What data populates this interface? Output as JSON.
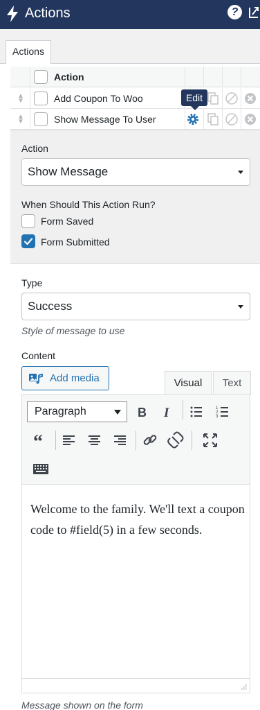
{
  "header": {
    "title": "Actions",
    "help_label": "?"
  },
  "tabs": {
    "actions_label": "Actions"
  },
  "table": {
    "column_action": "Action",
    "rows": [
      {
        "label": "Add Coupon To Woo"
      },
      {
        "label": "Show Message To User"
      }
    ],
    "tooltip": "Edit"
  },
  "settings": {
    "action_label": "Action",
    "action_value": "Show Message",
    "when_label": "When Should This Action Run?",
    "options": [
      {
        "label": "Form Saved",
        "checked": false
      },
      {
        "label": "Form Submitted",
        "checked": true
      }
    ]
  },
  "message": {
    "type_label": "Type",
    "type_value": "Success",
    "type_help": "Style of message to use",
    "content_label": "Content",
    "add_media_label": "Add media",
    "tab_visual": "Visual",
    "tab_text": "Text",
    "format_value": "Paragraph",
    "body": "Welcome to the family. We'll text a coupon code to #field(5) in a few seconds.",
    "content_help": "Message shown on the form"
  },
  "colors": {
    "header_bg": "#23375e",
    "accent": "#2271b1",
    "checked": "#2271b1"
  },
  "icons": [
    "bolt-icon",
    "help-icon",
    "expand-icon",
    "drag-handle-icon",
    "gear-icon",
    "duplicate-icon",
    "disable-icon",
    "delete-icon",
    "media-icon",
    "bold-icon",
    "italic-icon",
    "bullet-list-icon",
    "numbered-list-icon",
    "blockquote-icon",
    "align-left-icon",
    "align-center-icon",
    "align-right-icon",
    "link-icon",
    "unlink-icon",
    "fullscreen-icon",
    "toolbar-toggle-icon",
    "checkmark-icon"
  ]
}
